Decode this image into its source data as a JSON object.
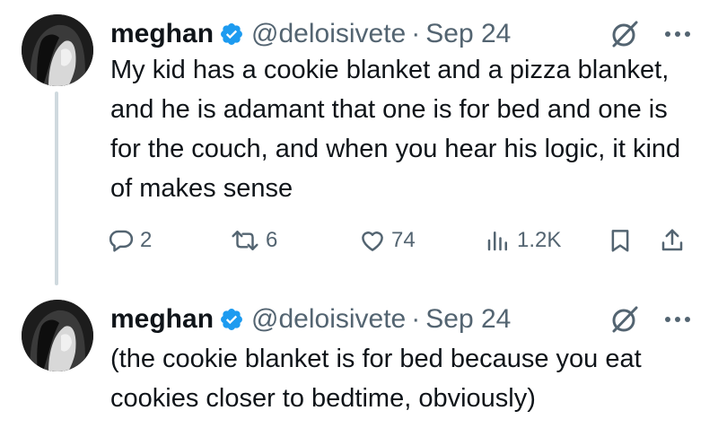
{
  "tweets": [
    {
      "author": {
        "name": "meghan",
        "handle": "@deloisivete",
        "verified": true
      },
      "separator": "·",
      "date": "Sep 24",
      "text": "My kid has a cookie blanket and a pizza blanket, and he is adamant that one is for bed and one is for the couch, and when you hear his logic, it kind of makes sense",
      "actions": {
        "replies": "2",
        "reposts": "6",
        "likes": "74",
        "views": "1.2K"
      }
    },
    {
      "author": {
        "name": "meghan",
        "handle": "@deloisivete",
        "verified": true
      },
      "separator": "·",
      "date": "Sep 24",
      "text": "(the cookie blanket is for bed because you eat cookies closer to bedtime, obviously)"
    }
  ],
  "icons": {
    "verified": "verified-badge-icon",
    "grok": "grok-icon",
    "more": "more-icon",
    "reply": "reply-icon",
    "repost": "repost-icon",
    "like": "like-icon",
    "views": "views-icon",
    "bookmark": "bookmark-icon",
    "share": "share-icon"
  },
  "colors": {
    "verified": "#1d9bf0",
    "text": "#0f1419",
    "secondary": "#536471",
    "thread_line": "#cfd9de"
  }
}
